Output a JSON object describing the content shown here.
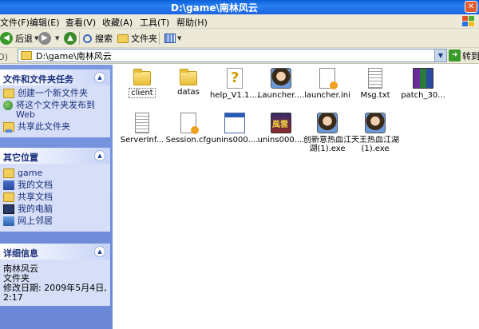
{
  "window": {
    "title": "D:\\game\\南林风云"
  },
  "menu": [
    "文件(F)",
    "编辑(E)",
    "查看(V)",
    "收藏(A)",
    "工具(T)",
    "帮助(H)"
  ],
  "toolbar": {
    "back": "后退",
    "search": "搜索",
    "folders": "文件夹"
  },
  "address": {
    "label": "址(D)",
    "value": "D:\\game\\南林风云",
    "go": "转到"
  },
  "tasks_panel": {
    "title": "文件和文件夹任务",
    "items": [
      "创建一个新文件夹",
      "将这个文件夹发布到 Web",
      "共享此文件夹"
    ]
  },
  "places_panel": {
    "title": "其它位置",
    "items": [
      "game",
      "我的文档",
      "共享文档",
      "我的电脑",
      "网上邻居"
    ]
  },
  "details_panel": {
    "title": "详细信息",
    "name": "南林风云",
    "type": "文件夹",
    "modified": "修改日期: 2009年5月4日, 2:17"
  },
  "files": [
    {
      "name": "client",
      "icon": "folder-icon",
      "selected": true
    },
    {
      "name": "datas",
      "icon": "folder-icon"
    },
    {
      "name": "help_V1.1....",
      "icon": "help-file-icon"
    },
    {
      "name": "Launcher....",
      "icon": "launcher-avatar-icon"
    },
    {
      "name": "launcher.ini",
      "icon": "ini-file-icon"
    },
    {
      "name": "Msg.txt",
      "icon": "text-file-icon"
    },
    {
      "name": "patch_30...",
      "icon": "rar-archive-icon"
    },
    {
      "name": "ServerInf...",
      "icon": "text-file-icon"
    },
    {
      "name": "Session.cfg",
      "icon": "cfg-file-icon"
    },
    {
      "name": "unins000....",
      "icon": "uninstaller-icon"
    },
    {
      "name": "unins000....",
      "icon": "game-logo-icon"
    },
    {
      "name": "创新意热血江湖(1).exe",
      "icon": "game-avatar-icon"
    },
    {
      "name": "天王热血江湖(1).exe",
      "icon": "game-avatar-icon"
    }
  ]
}
